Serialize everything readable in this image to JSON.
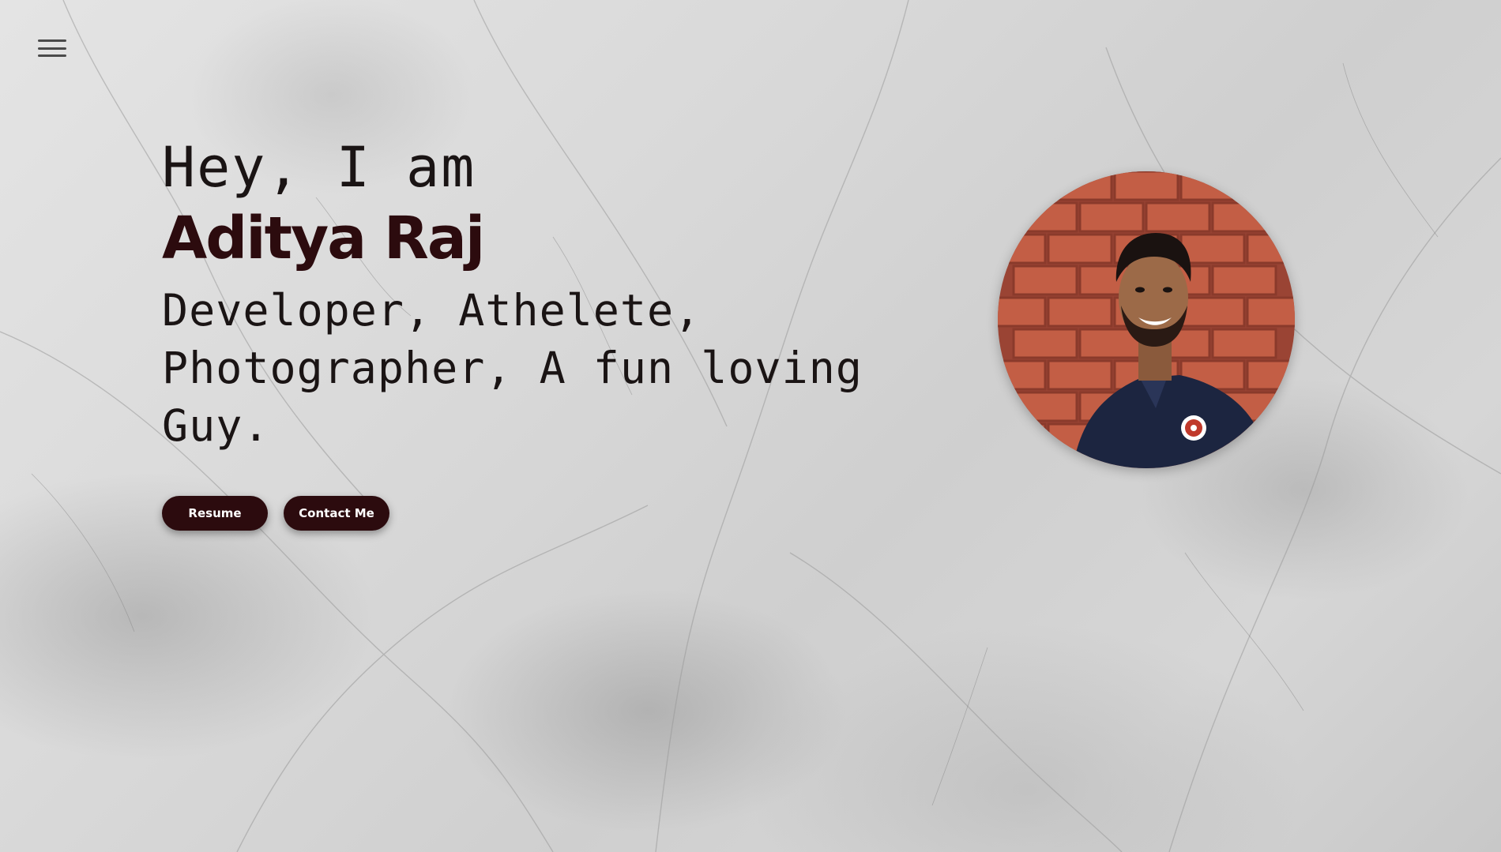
{
  "nav": {
    "menu_icon": "hamburger-menu-icon"
  },
  "hero": {
    "greeting": "Hey, I am",
    "name": "Aditya Raj",
    "tagline": "Developer, Athelete, Photographer, A fun loving Guy.",
    "buttons": {
      "resume_label": "Resume",
      "contact_label": "Contact Me"
    }
  },
  "profile": {
    "photo_icon": "profile-photo"
  },
  "colors": {
    "accent": "#2c0b0e",
    "text": "#1a1414",
    "background": "#d9d9d9",
    "brick": "#b8523c",
    "shirt": "#1c2540"
  }
}
